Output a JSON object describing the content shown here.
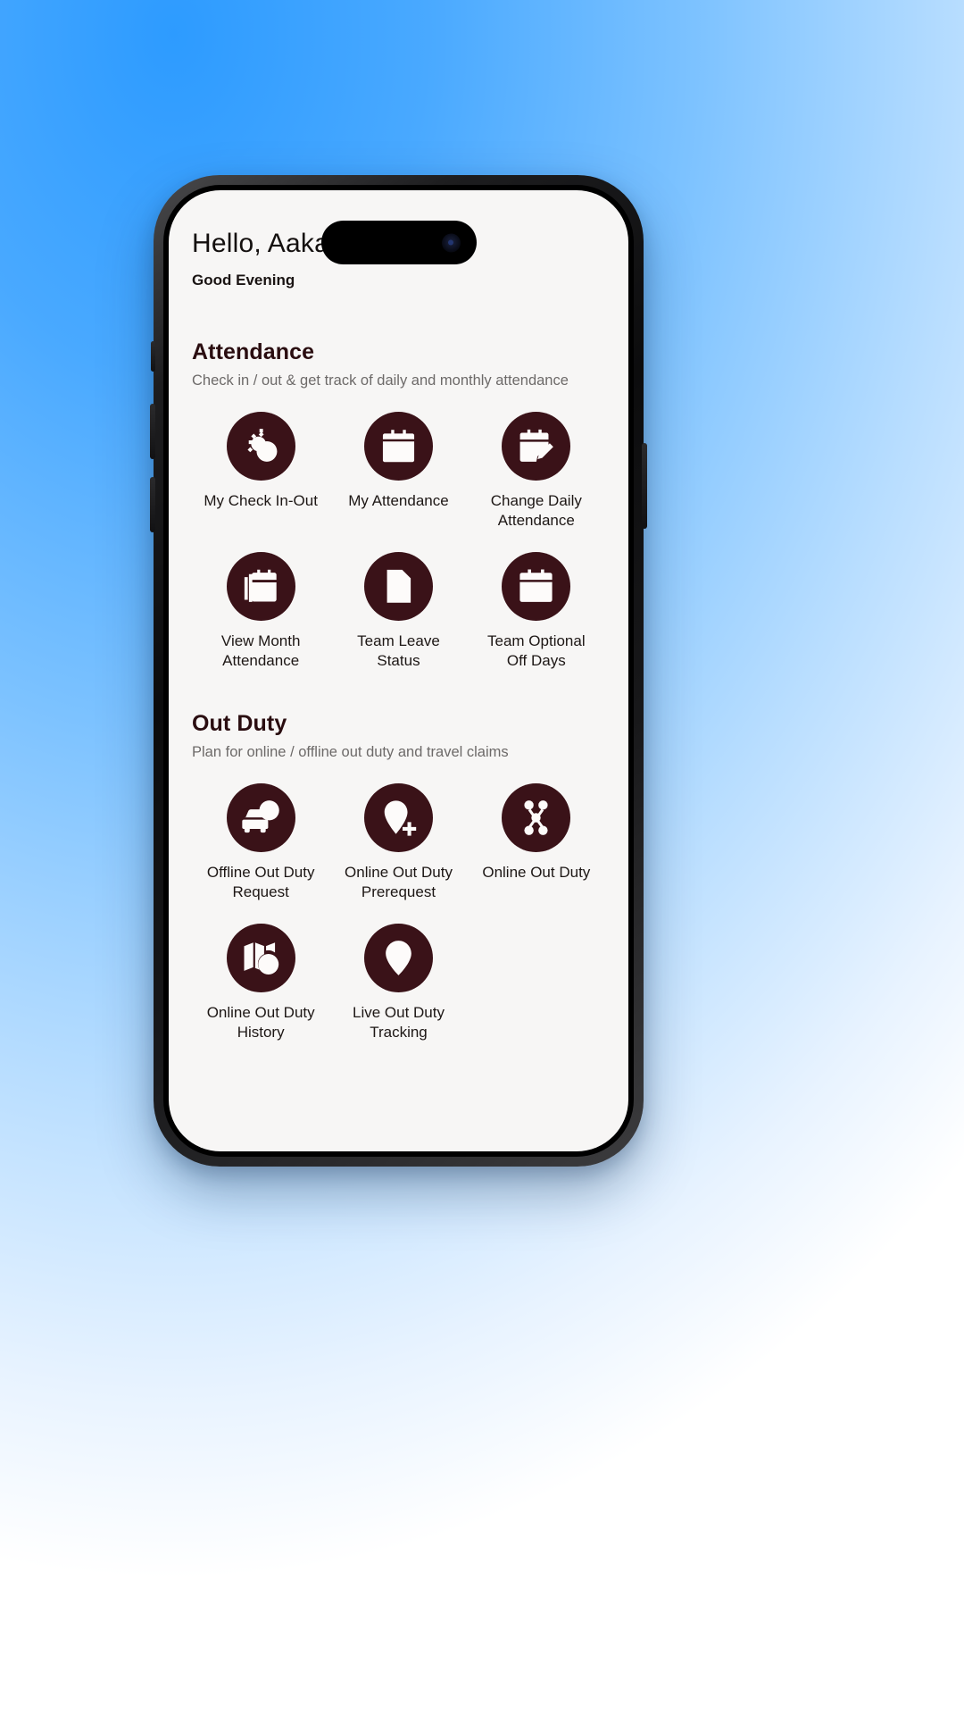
{
  "background": {
    "accent_color": "#3a9bff"
  },
  "phone": {
    "screen_background": "#f7f6f5",
    "icon_circle_color": "#3a1218"
  },
  "header": {
    "greeting": "Hello,  Aakash",
    "time_of_day": "Good Evening"
  },
  "sections": [
    {
      "id": "attendance",
      "title": "Attendance",
      "subtitle": "Check in / out & get track of daily and monthly attendance",
      "tiles": [
        {
          "id": "my-check-in-out",
          "label": "My Check In-Out",
          "icon": "alarm-clock-icon"
        },
        {
          "id": "my-attendance",
          "label": "My Attendance",
          "icon": "calendar-icon"
        },
        {
          "id": "change-daily-attendance",
          "label": "Change Daily\nAttendance",
          "icon": "calendar-edit-icon"
        },
        {
          "id": "view-month-attendance",
          "label": "View Month\nAttendance",
          "icon": "calendar-check-stack-icon"
        },
        {
          "id": "team-leave-status",
          "label": "Team Leave\nStatus",
          "icon": "document-person-icon"
        },
        {
          "id": "team-optional-off-days",
          "label": "Team Optional\nOff Days",
          "icon": "calendar-grid-icon"
        }
      ]
    },
    {
      "id": "out-duty",
      "title": "Out Duty",
      "subtitle": "Plan for online / offline out duty and travel claims",
      "tiles": [
        {
          "id": "offline-out-duty-request",
          "label": "Offline Out Duty\nRequest",
          "icon": "car-clock-icon"
        },
        {
          "id": "online-out-duty-prerequest",
          "label": "Online Out Duty\nPrerequest",
          "icon": "map-pin-plus-icon"
        },
        {
          "id": "online-out-duty",
          "label": "Online Out Duty",
          "icon": "route-pins-icon"
        },
        {
          "id": "online-out-duty-history",
          "label": "Online Out Duty\nHistory",
          "icon": "map-clock-icon"
        },
        {
          "id": "live-out-duty-tracking",
          "label": "Live Out Duty\nTracking",
          "icon": "map-pin-person-icon"
        }
      ]
    }
  ]
}
